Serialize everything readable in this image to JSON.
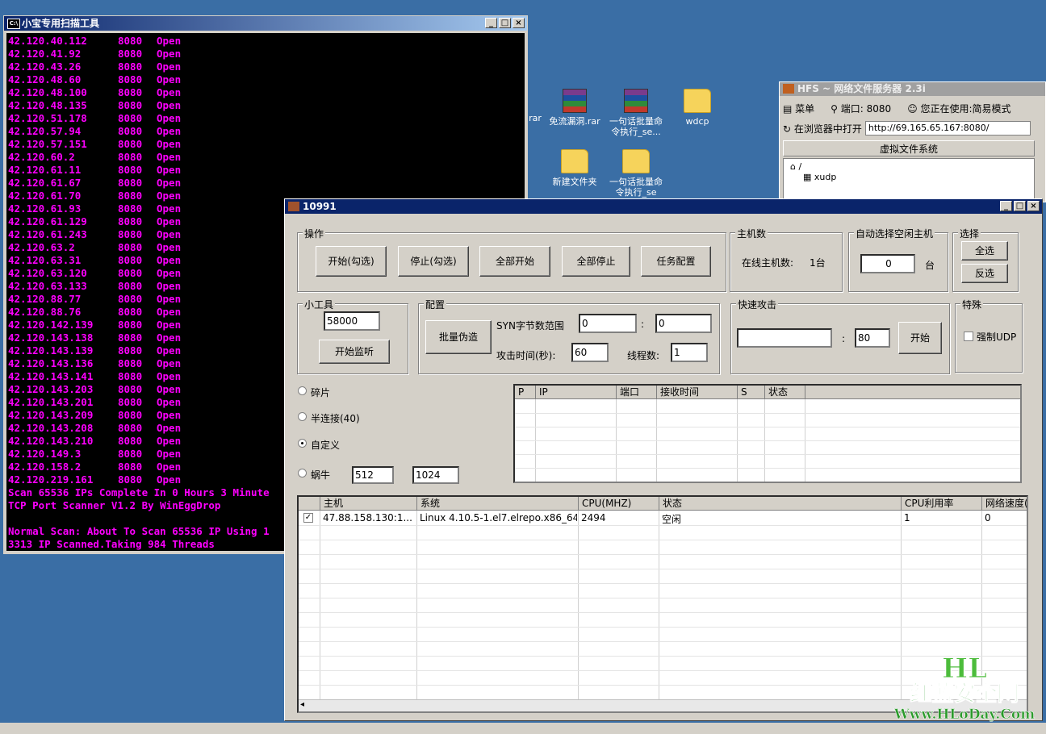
{
  "cmd_window": {
    "title": "小宝专用扫描工具",
    "title_buttons": [
      "_",
      "□",
      "×"
    ],
    "rows": [
      {
        "ip": "42.120.40.112",
        "port": "8080",
        "status": "Open"
      },
      {
        "ip": "42.120.41.92",
        "port": "8080",
        "status": "Open"
      },
      {
        "ip": "42.120.43.26",
        "port": "8080",
        "status": "Open"
      },
      {
        "ip": "42.120.48.60",
        "port": "8080",
        "status": "Open"
      },
      {
        "ip": "42.120.48.100",
        "port": "8080",
        "status": "Open"
      },
      {
        "ip": "42.120.48.135",
        "port": "8080",
        "status": "Open"
      },
      {
        "ip": "42.120.51.178",
        "port": "8080",
        "status": "Open"
      },
      {
        "ip": "42.120.57.94",
        "port": "8080",
        "status": "Open"
      },
      {
        "ip": "42.120.57.151",
        "port": "8080",
        "status": "Open"
      },
      {
        "ip": "42.120.60.2",
        "port": "8080",
        "status": "Open"
      },
      {
        "ip": "42.120.61.11",
        "port": "8080",
        "status": "Open"
      },
      {
        "ip": "42.120.61.67",
        "port": "8080",
        "status": "Open"
      },
      {
        "ip": "42.120.61.70",
        "port": "8080",
        "status": "Open"
      },
      {
        "ip": "42.120.61.93",
        "port": "8080",
        "status": "Open"
      },
      {
        "ip": "42.120.61.129",
        "port": "8080",
        "status": "Open"
      },
      {
        "ip": "42.120.61.243",
        "port": "8080",
        "status": "Open"
      },
      {
        "ip": "42.120.63.2",
        "port": "8080",
        "status": "Open"
      },
      {
        "ip": "42.120.63.31",
        "port": "8080",
        "status": "Open"
      },
      {
        "ip": "42.120.63.120",
        "port": "8080",
        "status": "Open"
      },
      {
        "ip": "42.120.63.133",
        "port": "8080",
        "status": "Open"
      },
      {
        "ip": "42.120.88.77",
        "port": "8080",
        "status": "Open"
      },
      {
        "ip": "42.120.88.76",
        "port": "8080",
        "status": "Open"
      },
      {
        "ip": "42.120.142.139",
        "port": "8080",
        "status": "Open"
      },
      {
        "ip": "42.120.143.138",
        "port": "8080",
        "status": "Open"
      },
      {
        "ip": "42.120.143.139",
        "port": "8080",
        "status": "Open"
      },
      {
        "ip": "42.120.143.136",
        "port": "8080",
        "status": "Open"
      },
      {
        "ip": "42.120.143.141",
        "port": "8080",
        "status": "Open"
      },
      {
        "ip": "42.120.143.203",
        "port": "8080",
        "status": "Open"
      },
      {
        "ip": "42.120.143.201",
        "port": "8080",
        "status": "Open"
      },
      {
        "ip": "42.120.143.209",
        "port": "8080",
        "status": "Open"
      },
      {
        "ip": "42.120.143.208",
        "port": "8080",
        "status": "Open"
      },
      {
        "ip": "42.120.143.210",
        "port": "8080",
        "status": "Open"
      },
      {
        "ip": "42.120.149.3",
        "port": "8080",
        "status": "Open"
      },
      {
        "ip": "42.120.158.2",
        "port": "8080",
        "status": "Open"
      },
      {
        "ip": "42.120.219.161",
        "port": "8080",
        "status": "Open"
      }
    ],
    "summary_line": "Scan 65536 IPs Complete In 0 Hours 3 Minute",
    "credit_line": "TCP Port Scanner V1.2 By WinEggDrop",
    "blank_line": "",
    "normal_scan_line": "Normal Scan: About To Scan 65536 IP Using 1",
    "scanned_line": "3313 IP Scanned.Taking 984 Threads"
  },
  "desktop": {
    "icons": [
      {
        "label_line1": "rar",
        "label_line2": "",
        "type": "rar-partial"
      },
      {
        "label_line1": "免流漏洞.rar",
        "label_line2": "",
        "type": "rar"
      },
      {
        "label_line1": "一句话批量命",
        "label_line2": "令执行_se...",
        "type": "rar"
      },
      {
        "label_line1": "wdcp",
        "label_line2": "",
        "type": "folder"
      },
      {
        "label_line1": "新建文件夹",
        "label_line2": "",
        "type": "folder"
      },
      {
        "label_line1": "一句话批量命",
        "label_line2": "令执行_se",
        "type": "folder"
      }
    ]
  },
  "hfs_window": {
    "title": "HFS ~ 网络文件服务器 2.3i",
    "menu_label": "菜单",
    "port_label": "端口: 8080",
    "mode_label": "您正在使用:简易模式",
    "open_in_browser": "在浏览器中打开",
    "url": "http://69.165.65.167:8080/",
    "vfs_header": "虚拟文件系统",
    "tree_root": "/",
    "tree_child": "xudp"
  },
  "main_window": {
    "title": "10991",
    "title_buttons": [
      "_",
      "□",
      "×"
    ],
    "ops_group": {
      "label": "操作",
      "buttons": [
        "开始(勾选)",
        "停止(勾选)",
        "全部开始",
        "全部停止",
        "任务配置"
      ]
    },
    "hosts_group": {
      "label": "主机数",
      "online_label": "在线主机数:",
      "online_count": "1台"
    },
    "auto_group": {
      "label": "自动选择空闲主机",
      "value": "0",
      "unit": "台"
    },
    "select_group": {
      "label": "选择",
      "select_all": "全选",
      "invert": "反选"
    },
    "tools_group": {
      "label": "小工具",
      "port_value": "58000",
      "listen_button": "开始监听"
    },
    "config_group": {
      "label": "配置",
      "batch_button": "批量伪造",
      "syn_label": "SYN字节数范围",
      "syn_from": "0",
      "syn_sep": ":",
      "syn_to": "0",
      "time_label": "攻击时间(秒):",
      "time_value": "60",
      "threads_label": "线程数:",
      "threads_value": "1"
    },
    "quick_group": {
      "label": "快速攻击",
      "target_value": "",
      "sep": ":",
      "port_value": "80",
      "start_button": "开始"
    },
    "special_group": {
      "label": "特殊",
      "force_udp": "强制UDP",
      "force_udp_checked": false
    },
    "modes": [
      {
        "label": "碎片",
        "selected": false
      },
      {
        "label": "半连接(40)",
        "selected": false
      },
      {
        "label": "自定义",
        "selected": true
      },
      {
        "label": "蜗牛",
        "selected": false
      }
    ],
    "snail_value1": "512",
    "snail_value2": "1024",
    "result_table": {
      "columns": [
        "P",
        "IP",
        "端口",
        "接收时间",
        "S",
        "状态"
      ]
    },
    "host_table": {
      "columns": [
        "",
        "主机",
        "系统",
        "CPU(MHZ)",
        "状态",
        "CPU利用率",
        "网络速度("
      ],
      "rows": [
        {
          "checked": true,
          "host": "47.88.158.130:1...",
          "system": "Linux 4.10.5-1.el7.elrepo.x86_64",
          "cpu_mhz": "2494",
          "status": "空闲",
          "cpu_usage": "1",
          "net_speed": "0"
        }
      ]
    }
  },
  "watermark": {
    "logo": "HL",
    "name": "红蓝安全网",
    "url": "Www.HLoDay.Com"
  }
}
